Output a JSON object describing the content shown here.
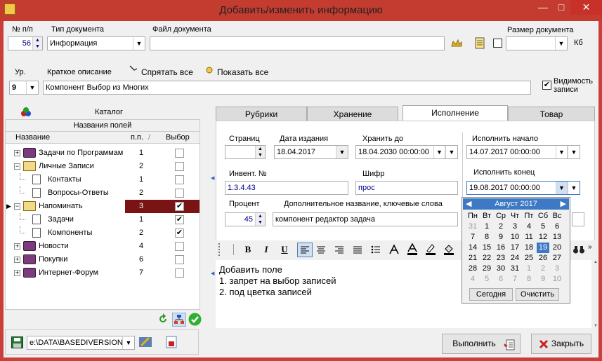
{
  "window": {
    "title": "Добавить/изменить информацию",
    "min_glyph": "—",
    "max_glyph": "□",
    "close_glyph": "✕"
  },
  "top": {
    "num_label": "№ п/п",
    "num_value": "56",
    "doctype_label": "Тип документа",
    "doctype_value": "Информация",
    "file_label": "Файл документа",
    "file_value": "",
    "size_label": "Размер документа",
    "size_unit": "Кб",
    "size_value": ""
  },
  "second": {
    "level_label": "Ур.",
    "level_value": "9",
    "short_desc_label": "Краткое описание",
    "hide_all_label": "Спрятать все",
    "show_all_label": "Показать все",
    "short_desc_value": "Компонент Выбор из Многих",
    "visibility_label": "Видимость записи",
    "visibility_checked": true
  },
  "catalog": {
    "title": "Каталог",
    "fields_header": "Названия полей",
    "col_name": "Название",
    "col_num": "п.п.",
    "col_sort": "/",
    "col_choice": "Выбор",
    "rows": [
      {
        "name": "Задачи по Программам",
        "num": "1",
        "level": 0,
        "icon": "closed-book-icon",
        "expander": "+",
        "checked": false
      },
      {
        "name": "Личные Записи",
        "num": "2",
        "level": 0,
        "icon": "open-book-icon",
        "expander": "−",
        "checked": false
      },
      {
        "name": "Контакты",
        "num": "1",
        "level": 1,
        "icon": "document-icon",
        "expander": "",
        "checked": false
      },
      {
        "name": "Вопросы-Ответы",
        "num": "2",
        "level": 1,
        "icon": "document-icon",
        "expander": "",
        "checked": false
      },
      {
        "name": "Напоминать",
        "num": "3",
        "level": 0,
        "icon": "open-book-icon",
        "expander": "−",
        "checked": true,
        "selected": true
      },
      {
        "name": "Задачи",
        "num": "1",
        "level": 1,
        "icon": "document-icon",
        "expander": "",
        "checked": true
      },
      {
        "name": "Компоненты",
        "num": "2",
        "level": 1,
        "icon": "document-icon",
        "expander": "",
        "checked": true
      },
      {
        "name": "Новости",
        "num": "4",
        "level": 0,
        "icon": "closed-book-icon",
        "expander": "+",
        "checked": false
      },
      {
        "name": "Покупки",
        "num": "6",
        "level": 0,
        "icon": "closed-book-icon",
        "expander": "+",
        "checked": false
      },
      {
        "name": "Интернет-Форум",
        "num": "7",
        "level": 0,
        "icon": "closed-book-icon",
        "expander": "+",
        "checked": false
      }
    ]
  },
  "tabs": [
    "Рубрики",
    "Хранение",
    "Исполнение",
    "Товар"
  ],
  "active_tab": "Исполнение",
  "exec": {
    "pages_label": "Страниц",
    "pages_value": "",
    "pubdate_label": "Дата издания",
    "pubdate_value": "18.04.2017",
    "keep_label": "Хранить до",
    "keep_value": "18.04.2030 00:00:00",
    "start_label": "Исполнить начало",
    "start_value": "14.07.2017 00:00:00",
    "inv_label": "Инвент. №",
    "inv_value": "1.3.4.43",
    "cipher_label": "Шифр",
    "cipher_value": "прос",
    "end_label": "Исполнить конец",
    "end_value": "19.08.2017 00:00:00",
    "percent_label": "Процент",
    "percent_value": "45",
    "extra_label": "Дополнительное название, ключевые слова",
    "extra_value": "компонент редактор задача"
  },
  "calendar": {
    "month": "Август 2017",
    "prev": "◀",
    "next": "▶",
    "weekdays": [
      "Пн",
      "Вт",
      "Ср",
      "Чт",
      "Пт",
      "Сб",
      "Вс"
    ],
    "weeks": [
      [
        "31",
        "1",
        "2",
        "3",
        "4",
        "5",
        "6"
      ],
      [
        "7",
        "8",
        "9",
        "10",
        "11",
        "12",
        "13"
      ],
      [
        "14",
        "15",
        "16",
        "17",
        "18",
        "19",
        "20"
      ],
      [
        "21",
        "22",
        "23",
        "24",
        "25",
        "26",
        "27"
      ],
      [
        "28",
        "29",
        "30",
        "31",
        "1",
        "2",
        "3"
      ],
      [
        "4",
        "5",
        "6",
        "7",
        "8",
        "9",
        "10"
      ]
    ],
    "selected_day": "19",
    "today_button": "Сегодня",
    "clear_button": "Очистить"
  },
  "editor": {
    "toolbar": [
      "B",
      "I",
      "U"
    ],
    "lines": [
      "Добавить поле",
      "1. запрет  на выбор записей",
      "2. под цветка записей"
    ]
  },
  "bottom": {
    "path_value": "e:\\DATA\\BASEDIVERSION",
    "execute_button": "Выполнить",
    "close_button": "Закрыть"
  }
}
